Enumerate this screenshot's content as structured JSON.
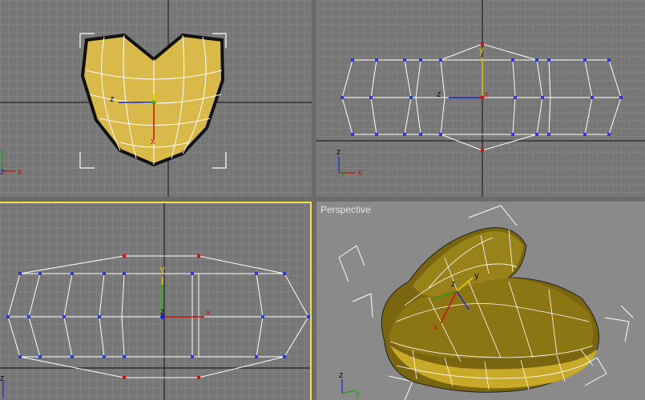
{
  "viewports": {
    "top": {
      "label": ""
    },
    "front": {
      "label": ""
    },
    "left": {
      "label": ""
    },
    "perspective": {
      "label": "Perspective"
    }
  },
  "axes": {
    "x": "x",
    "y": "y",
    "z": "z"
  },
  "colors": {
    "grid_minor": "#888888",
    "grid_major": "#222222",
    "mesh_fill": "#d9b94a",
    "mesh_persp": "#7a6610",
    "vertex": "#2a38d8",
    "selected_vertex": "#d01010",
    "active_border": "#f2e04a",
    "axis_x": "#d01010",
    "axis_y": "#18a018",
    "axis_z": "#1828c8",
    "gizmo_y": "#e6d000"
  }
}
